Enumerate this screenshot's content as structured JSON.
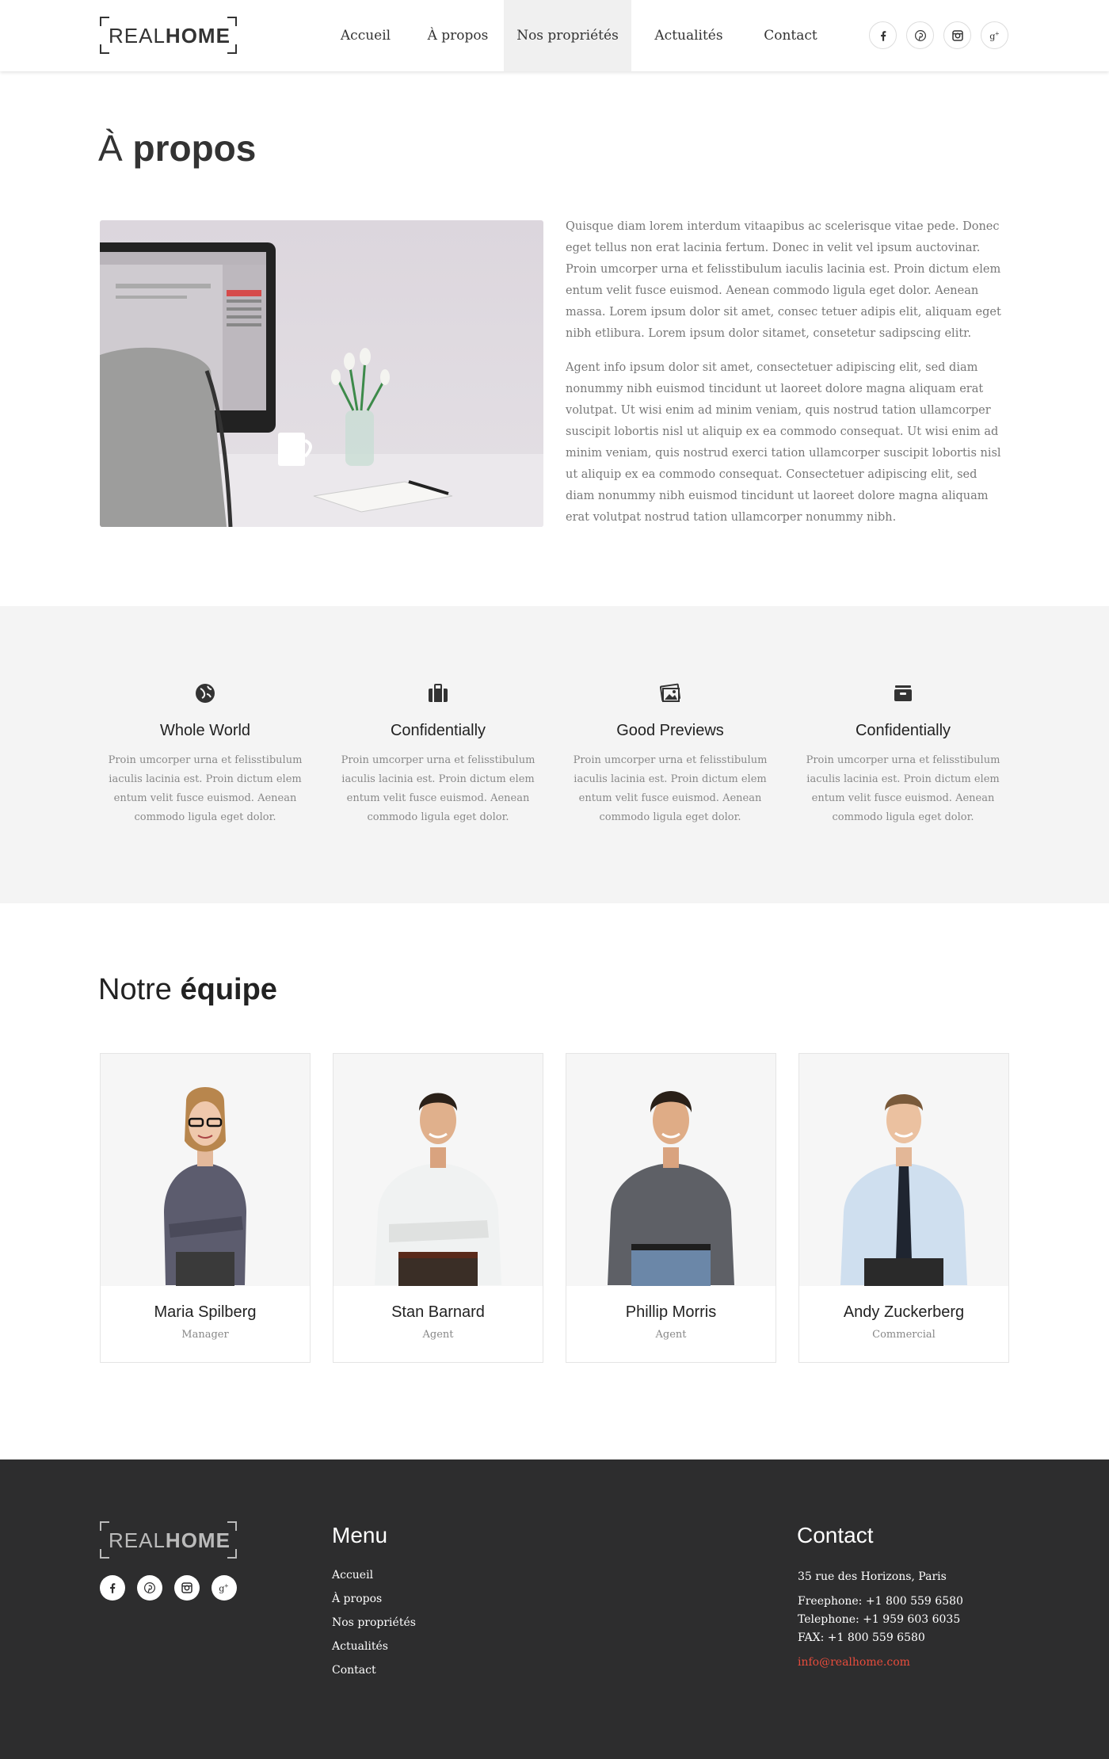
{
  "brand": {
    "logo_light": "REAL",
    "logo_bold": "HOME"
  },
  "nav": {
    "items": [
      {
        "label": "Accueil"
      },
      {
        "label": "À propos"
      },
      {
        "label": "Nos propriétés",
        "active": true
      },
      {
        "label": "Actualités"
      },
      {
        "label": "Contact"
      }
    ]
  },
  "social_icons": [
    "facebook-icon",
    "pinterest-icon",
    "instagram-icon",
    "google-plus-icon"
  ],
  "about": {
    "title_light": "À",
    "title_bold": "propos",
    "paragraphs": [
      "Quisque diam lorem interdum vitaapibus ac scelerisque vitae pede. Donec eget tellus non erat lacinia fertum. Donec in velit vel ipsum auctovinar. Proin umcorper urna et felisstibulum iaculis lacinia est. Proin dictum elem entum velit fusce euismod. Aenean commodo ligula eget dolor. Aenean massa. Lorem ipsum dolor sit amet, consec tetuer adipis elit, aliquam eget nibh etlibura. Lorem ipsum dolor sitamet, consetetur sadipscing elitr.",
      "Agent info ipsum dolor sit amet, consectetuer adipiscing elit, sed diam nonummy nibh euismod tincidunt ut laoreet dolore magna aliquam erat volutpat. Ut wisi enim ad minim veniam, quis nostrud tation ullamcorper suscipit lobortis nisl ut aliquip ex ea commodo consequat. Ut wisi enim ad minim veniam, quis nostrud exerci tation ullamcorper suscipit lobortis nisl ut aliquip ex ea commodo consequat. Consectetuer adipiscing elit, sed diam nonummy nibh euismod tincidunt ut laoreet dolore magna aliquam erat volutpat nostrud tation ullamcorper nonummy nibh."
    ]
  },
  "features": [
    {
      "icon": "globe-icon",
      "title": "Whole World",
      "text": "Proin umcorper urna et felisstibulum iaculis lacinia est. Proin dictum elem entum velit fusce euismod. Aenean commodo ligula eget dolor."
    },
    {
      "icon": "briefcase-icon",
      "title": "Confidentially",
      "text": "Proin umcorper urna et felisstibulum iaculis lacinia est. Proin dictum elem entum velit fusce euismod. Aenean commodo ligula eget dolor."
    },
    {
      "icon": "pictures-icon",
      "title": "Good Previews",
      "text": "Proin umcorper urna et felisstibulum iaculis lacinia est. Proin dictum elem entum velit fusce euismod. Aenean commodo ligula eget dolor."
    },
    {
      "icon": "archive-icon",
      "title": "Confidentially",
      "text": "Proin umcorper urna et felisstibulum iaculis lacinia est. Proin dictum elem entum velit fusce euismod. Aenean commodo ligula eget dolor."
    }
  ],
  "team": {
    "title_light": "Notre",
    "title_bold": "équipe",
    "members": [
      {
        "name": "Maria Spilberg",
        "role": "Manager"
      },
      {
        "name": "Stan Barnard",
        "role": "Agent"
      },
      {
        "name": "Phillip Morris",
        "role": "Agent"
      },
      {
        "name": "Andy Zuckerberg",
        "role": "Commercial"
      }
    ]
  },
  "footer": {
    "menu_title": "Menu",
    "menu_items": [
      "Accueil",
      "À propos",
      "Nos propriétés",
      "Actualités",
      "Contact"
    ],
    "contact_title": "Contact",
    "address": "35 rue des Horizons, Paris",
    "freephone": "Freephone: +1 800 559 6580",
    "telephone": "Telephone: +1 959 603 6035",
    "fax": "FAX: +1 800 559 6580",
    "email": "info@realhome.com"
  },
  "colors": {
    "accent": "#e74c3c",
    "footer_bg": "#2d2d2e",
    "features_bg": "#f4f4f4",
    "nav_active_bg": "#f0f0f0"
  }
}
